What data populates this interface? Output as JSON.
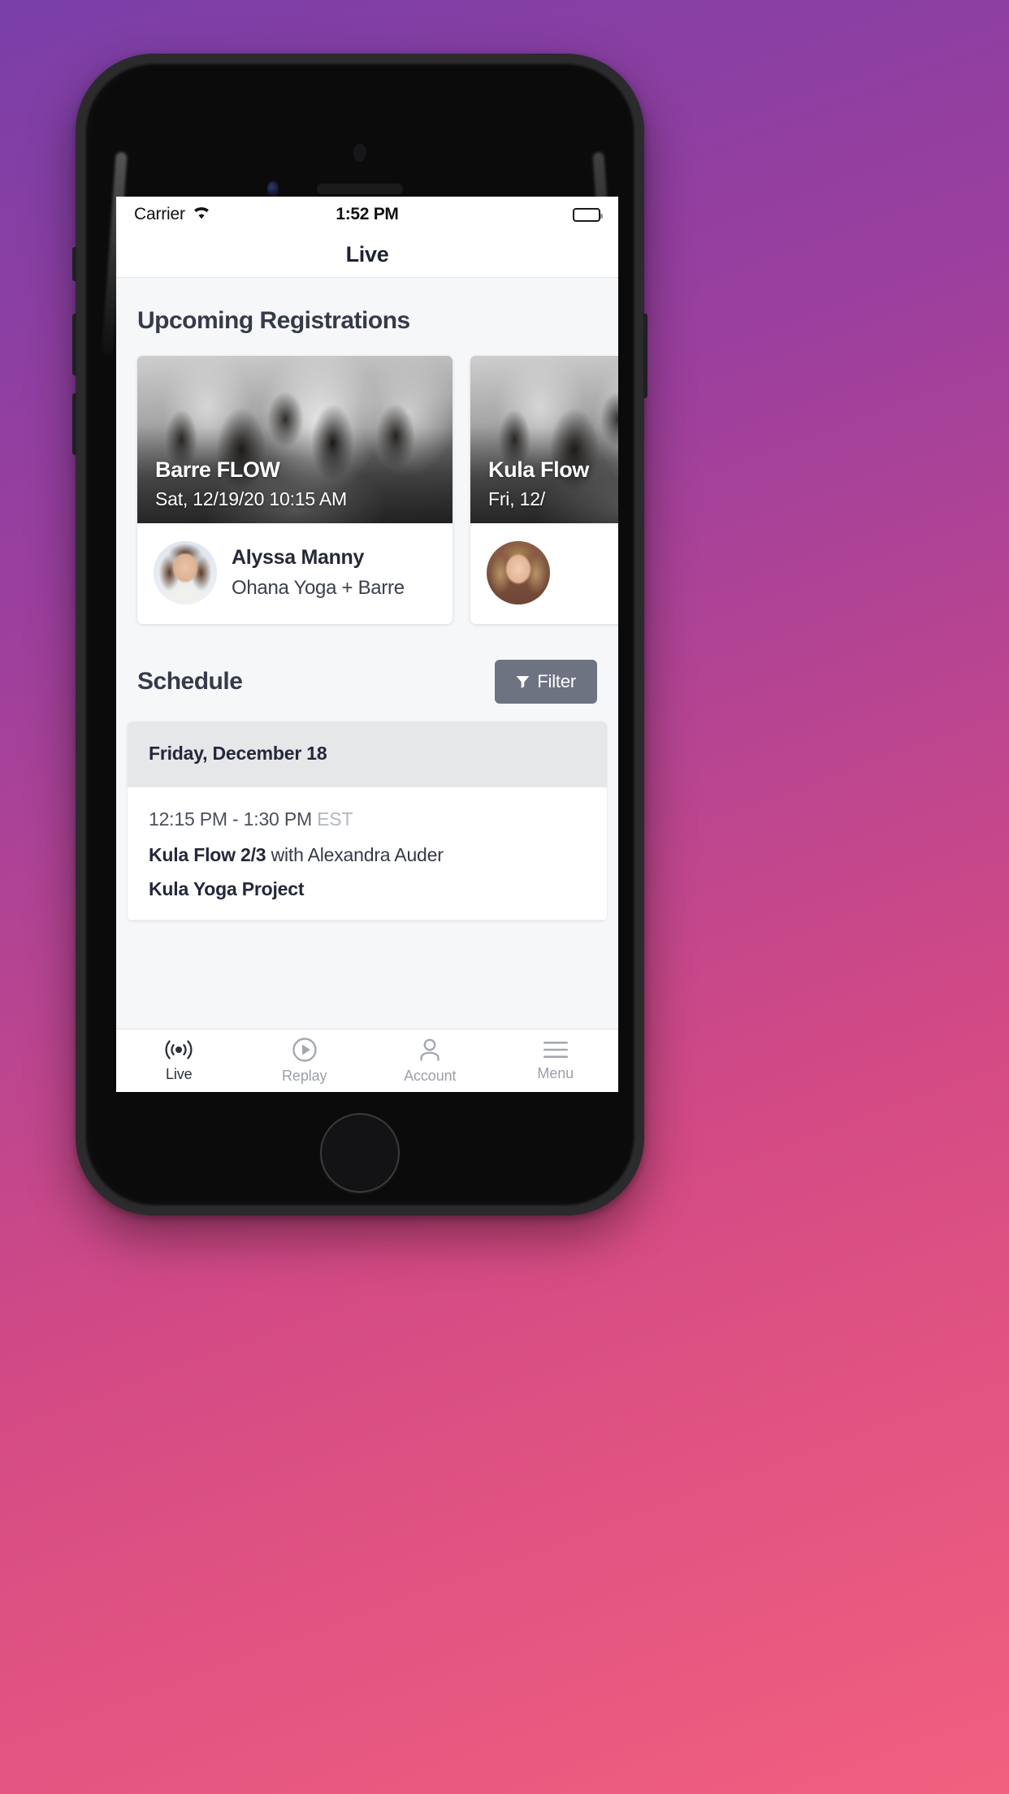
{
  "status_bar": {
    "carrier": "Carrier",
    "wifi_icon": "wifi-icon",
    "time": "1:52 PM",
    "battery_icon": "battery-full-icon"
  },
  "navbar": {
    "title": "Live"
  },
  "upcoming": {
    "section_title": "Upcoming Registrations",
    "cards": [
      {
        "title": "Barre FLOW",
        "datetime": "Sat, 12/19/20 10:15 AM",
        "instructor": "Alyssa Manny",
        "studio": "Ohana Yoga + Barre"
      },
      {
        "title": "Kula Flow",
        "datetime": "Fri, 12/",
        "instructor": "",
        "studio": ""
      }
    ]
  },
  "schedule": {
    "section_title": "Schedule",
    "filter_label": "Filter",
    "filter_icon": "funnel-icon",
    "days": [
      {
        "day_label": "Friday, December 18",
        "rows": [
          {
            "time": "12:15 PM - 1:30 PM",
            "timezone": "EST",
            "class_name": "Kula Flow 2/3",
            "with_word": "with",
            "teacher": "Alexandra Auder",
            "studio": "Kula Yoga Project"
          }
        ]
      }
    ]
  },
  "tabbar": {
    "tabs": [
      {
        "label": "Live",
        "icon": "broadcast-icon",
        "active": true
      },
      {
        "label": "Replay",
        "icon": "play-circle-icon",
        "active": false
      },
      {
        "label": "Account",
        "icon": "person-icon",
        "active": false
      },
      {
        "label": "Menu",
        "icon": "hamburger-menu-icon",
        "active": false
      }
    ]
  },
  "colors": {
    "accent_filter": "#6d7380",
    "background": "#f6f7f9",
    "text_dark": "#23283a"
  }
}
